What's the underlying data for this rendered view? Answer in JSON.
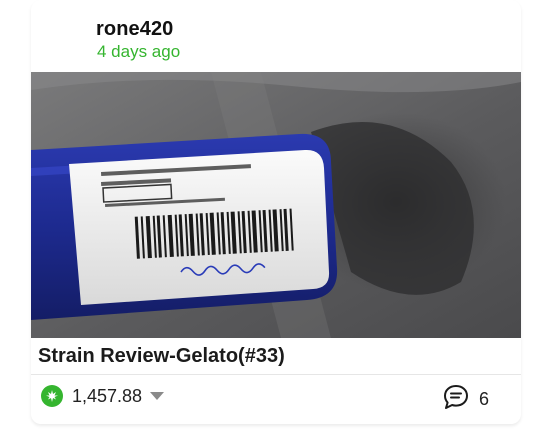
{
  "post": {
    "author": "rone420",
    "time_ago": "4 days ago",
    "title": "Strain Review-Gelato(#33)",
    "payout": "1,457.88",
    "comment_count": "6"
  },
  "photo_label": {
    "line1": "Pac: Gelato 33 - REC | AU-R-000182",
    "line2": "Net Weight: 3.5g",
    "thc": "18.78% THC",
    "metrc": "METRC: 1A4050300005552A000012795",
    "handwriting": "C9Gey K8wps"
  },
  "icons": {
    "vote": "leaf-icon",
    "caret": "caret-down-icon",
    "comments": "comment-bubble-icon"
  },
  "colors": {
    "accent_green": "#35b52f",
    "text_dark": "#1b1b1b",
    "bottle_blue": "#1d2a8f"
  }
}
